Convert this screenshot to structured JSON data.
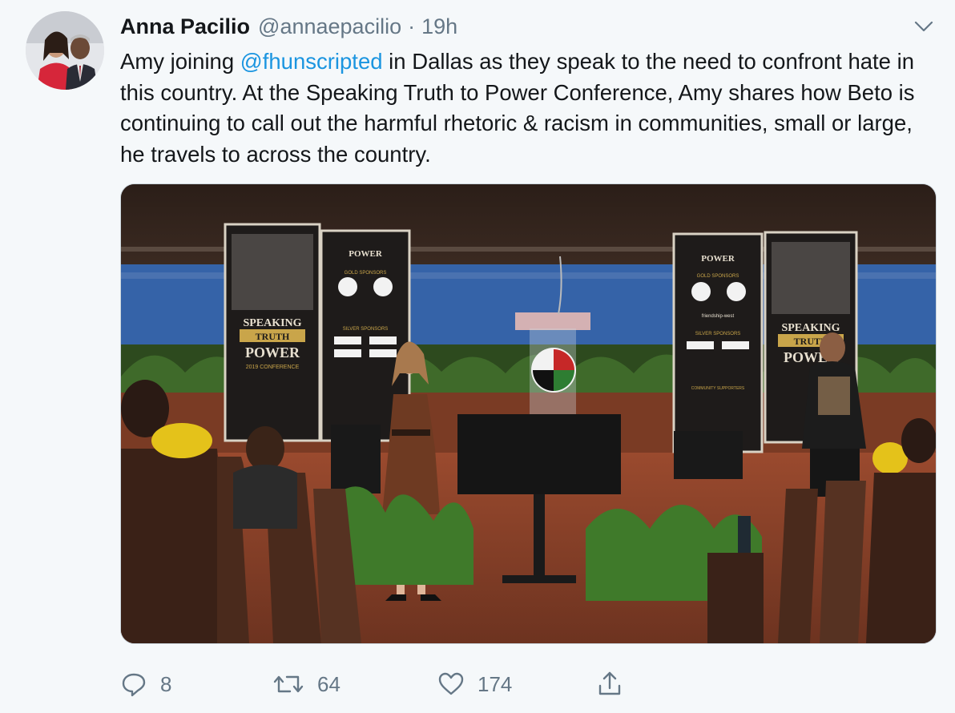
{
  "tweet": {
    "author_name": "Anna Pacilio",
    "handle": "@annaepacilio",
    "separator": "·",
    "time": "19h",
    "text_before": "Amy joining ",
    "mention": "@fhunscripted",
    "text_after": " in Dallas as they speak to the need to confront hate in this country. At the Speaking Truth to Power Conference, Amy shares how Beto is continuing to call out the harmful rhetoric & racism in communities, small or large, he travels to across the country."
  },
  "media": {
    "banner_left": {
      "line1": "SPEAKING",
      "line2": "TRUTH",
      "line3": "POWER",
      "line4": "2019 CONFERENCE"
    },
    "banner_right_top": {
      "line1": "SPEAKING",
      "line2": "TRUTH",
      "line3": "POWER",
      "gold": "GOLD SPONSORS",
      "silver": "SILVER SPONSORS",
      "community": "COMMUNITY SUPPORTERS",
      "fw": "friendship-west"
    }
  },
  "actions": {
    "reply_count": "8",
    "retweet_count": "64",
    "like_count": "174"
  },
  "colors": {
    "link": "#1b95e0",
    "secondary": "#657786",
    "background": "#f5f8fa"
  },
  "icons": [
    "chevron-down-icon",
    "reply-icon",
    "retweet-icon",
    "like-icon",
    "share-icon"
  ]
}
